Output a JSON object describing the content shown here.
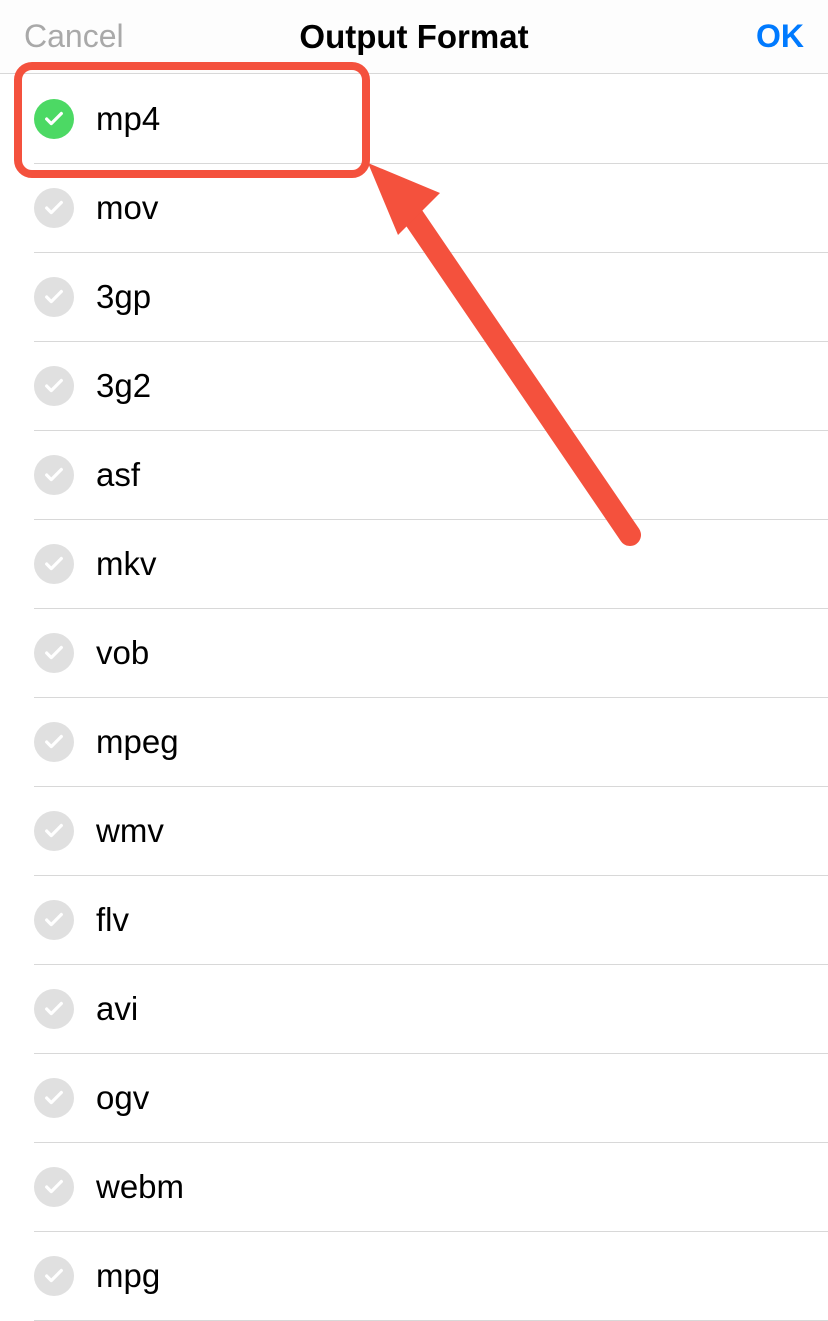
{
  "header": {
    "cancel_label": "Cancel",
    "title": "Output Format",
    "ok_label": "OK"
  },
  "formats": [
    {
      "label": "mp4",
      "selected": true
    },
    {
      "label": "mov",
      "selected": false
    },
    {
      "label": "3gp",
      "selected": false
    },
    {
      "label": "3g2",
      "selected": false
    },
    {
      "label": "asf",
      "selected": false
    },
    {
      "label": "mkv",
      "selected": false
    },
    {
      "label": "vob",
      "selected": false
    },
    {
      "label": "mpeg",
      "selected": false
    },
    {
      "label": "wmv",
      "selected": false
    },
    {
      "label": "flv",
      "selected": false
    },
    {
      "label": "avi",
      "selected": false
    },
    {
      "label": "ogv",
      "selected": false
    },
    {
      "label": "webm",
      "selected": false
    },
    {
      "label": "mpg",
      "selected": false
    }
  ],
  "annotation": {
    "highlight_color": "#f4513d"
  }
}
